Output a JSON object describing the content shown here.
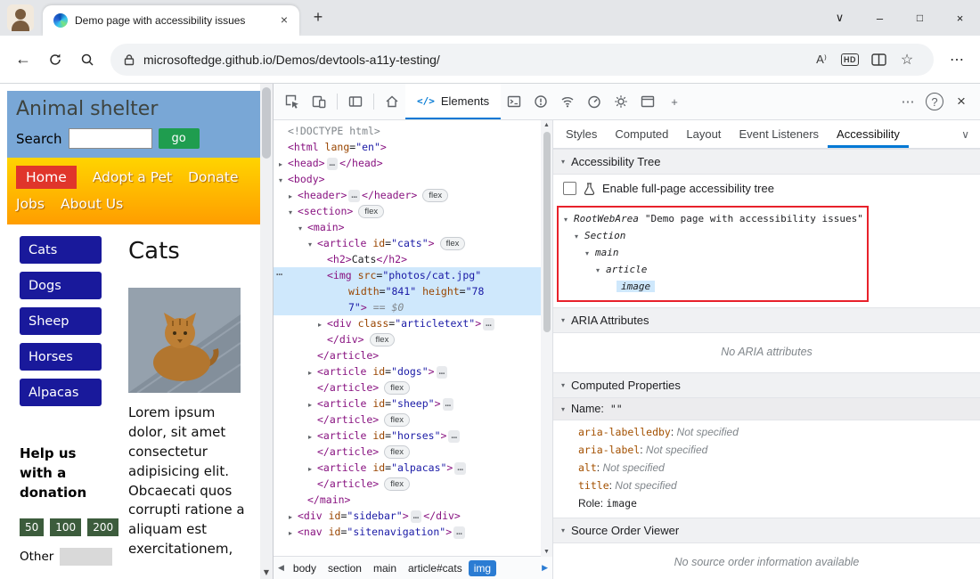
{
  "colors": {
    "devtools_accent": "#0078d4",
    "selection_highlight": "#cfe8fc",
    "inspect_highlight_red": "#e8212b",
    "code_tag": "#881280",
    "code_attr": "#994500",
    "code_value": "#1a1aa6",
    "page_header_blue": "#79a7d6",
    "page_nav_gradient_top": "#ffd400",
    "page_nav_gradient_bottom": "#ff9d00",
    "page_nav_active_red": "#e0352b",
    "page_button_navy": "#19199b",
    "page_go_green": "#1f9d4f",
    "page_donate_green": "#3c5c3c"
  },
  "icons": {
    "tab_close": "×",
    "new_tab": "+",
    "tab_search_chevron": "∨",
    "minimize": "–",
    "maximize": "□",
    "window_close": "×",
    "back": "←",
    "more": "⋯",
    "star": "☆",
    "read_aloud": "A⁾",
    "hd_badge": "HD",
    "help": "?",
    "devtools_close": "×",
    "elements_code": "</>",
    "add": "+",
    "crumb_left": "◀",
    "crumb_right": "▶",
    "scroll_up": "▲",
    "scroll_down": "▼",
    "collapsed": "▸",
    "expanded": "▾",
    "section_triangle": "▾",
    "panel_chevron": "∨",
    "node_menu": "…"
  },
  "browser": {
    "tab_title": "Demo page with accessibility issues",
    "url": "microsoftedge.github.io/Demos/devtools-a11y-testing/"
  },
  "webpage": {
    "title": "Animal shelter",
    "search_label": "Search",
    "go_button": "go",
    "active_nav": "Home",
    "nav_row1": [
      "Home",
      "Adopt a Pet",
      "Donate"
    ],
    "nav_row2": [
      "Jobs",
      "About Us"
    ],
    "category_buttons": [
      "Cats",
      "Dogs",
      "Sheep",
      "Horses",
      "Alpacas"
    ],
    "article_heading": "Cats",
    "article_text": "Lorem ipsum dolor, sit amet consectetur adipisicing elit. Obcaecati quos corrupti ratione a aliquam est exercitationem,",
    "donation_heading": "Help us with a donation",
    "donation_amounts": [
      "50",
      "100",
      "200"
    ],
    "other_label": "Other"
  },
  "devtools": {
    "elements_tab_label": "Elements",
    "panel_tabs": [
      "Styles",
      "Computed",
      "Layout",
      "Event Listeners",
      "Accessibility"
    ],
    "selected_panel_tab": "Accessibility",
    "breadcrumbs": [
      "body",
      "section",
      "main",
      "article#cats",
      "img"
    ],
    "selected_breadcrumb": "img",
    "tree_lines": [
      {
        "ind": 0,
        "segs": [
          [
            "doctype",
            "<!DOCTYPE html>"
          ]
        ]
      },
      {
        "ind": 0,
        "segs": [
          [
            "tag",
            "<html "
          ],
          [
            "attr",
            "lang"
          ],
          [
            "plain",
            "="
          ],
          [
            "val",
            "\"en\""
          ],
          [
            "tag",
            ">"
          ]
        ]
      },
      {
        "ind": 0,
        "arw": "c",
        "segs": [
          [
            "tag",
            "<head>"
          ],
          [
            "dots",
            "…"
          ],
          [
            "tag",
            "</head>"
          ]
        ]
      },
      {
        "ind": 0,
        "arw": "o",
        "segs": [
          [
            "tag",
            "<body>"
          ]
        ]
      },
      {
        "ind": 1,
        "arw": "c",
        "segs": [
          [
            "tag",
            "<header>"
          ],
          [
            "dots",
            "…"
          ],
          [
            "tag",
            "</header>"
          ],
          [
            "badge",
            "flex"
          ]
        ]
      },
      {
        "ind": 1,
        "arw": "o",
        "segs": [
          [
            "tag",
            "<section>"
          ],
          [
            "badge",
            "flex"
          ]
        ]
      },
      {
        "ind": 2,
        "arw": "o",
        "segs": [
          [
            "tag",
            "<main>"
          ]
        ]
      },
      {
        "ind": 3,
        "arw": "o",
        "segs": [
          [
            "tag",
            "<article "
          ],
          [
            "attr",
            "id"
          ],
          [
            "plain",
            "="
          ],
          [
            "val",
            "\"cats\""
          ],
          [
            "tag",
            ">"
          ],
          [
            "badge",
            "flex"
          ]
        ]
      },
      {
        "ind": 4,
        "segs": [
          [
            "tag",
            "<h2>"
          ],
          [
            "plain",
            "Cats"
          ],
          [
            "tag",
            "</h2>"
          ]
        ]
      },
      {
        "ind": 4,
        "sel": true,
        "gut": true,
        "segs": [
          [
            "tag",
            "<img "
          ],
          [
            "attr",
            "src"
          ],
          [
            "plain",
            "="
          ],
          [
            "val",
            "\"photos/cat.jpg\""
          ]
        ]
      },
      {
        "ind": 4,
        "sel": true,
        "cont": true,
        "segs": [
          [
            "attr",
            "width"
          ],
          [
            "plain",
            "="
          ],
          [
            "val",
            "\"841\""
          ],
          [
            "plain",
            " "
          ],
          [
            "attr",
            "height"
          ],
          [
            "plain",
            "="
          ],
          [
            "val",
            "\"78"
          ]
        ]
      },
      {
        "ind": 4,
        "sel": true,
        "cont": true,
        "segs": [
          [
            "val",
            "7\""
          ],
          [
            "tag",
            ">"
          ],
          [
            "eq",
            " == $0"
          ]
        ]
      },
      {
        "ind": 4,
        "arw": "c",
        "segs": [
          [
            "tag",
            "<div "
          ],
          [
            "attr",
            "class"
          ],
          [
            "plain",
            "="
          ],
          [
            "val",
            "\"articletext\""
          ],
          [
            "tag",
            ">"
          ],
          [
            "dots",
            "…"
          ]
        ]
      },
      {
        "ind": 4,
        "segs": [
          [
            "tag",
            "</div>"
          ],
          [
            "badge",
            "flex"
          ]
        ]
      },
      {
        "ind": 3,
        "segs": [
          [
            "tag",
            "</article>"
          ]
        ]
      },
      {
        "ind": 3,
        "arw": "c",
        "segs": [
          [
            "tag",
            "<article "
          ],
          [
            "attr",
            "id"
          ],
          [
            "plain",
            "="
          ],
          [
            "val",
            "\"dogs\""
          ],
          [
            "tag",
            ">"
          ],
          [
            "dots",
            "…"
          ]
        ]
      },
      {
        "ind": 3,
        "segs": [
          [
            "tag",
            "</article>"
          ],
          [
            "badge",
            "flex"
          ]
        ]
      },
      {
        "ind": 3,
        "arw": "c",
        "segs": [
          [
            "tag",
            "<article "
          ],
          [
            "attr",
            "id"
          ],
          [
            "plain",
            "="
          ],
          [
            "val",
            "\"sheep\""
          ],
          [
            "tag",
            ">"
          ],
          [
            "dots",
            "…"
          ]
        ]
      },
      {
        "ind": 3,
        "segs": [
          [
            "tag",
            "</article>"
          ],
          [
            "badge",
            "flex"
          ]
        ]
      },
      {
        "ind": 3,
        "arw": "c",
        "segs": [
          [
            "tag",
            "<article "
          ],
          [
            "attr",
            "id"
          ],
          [
            "plain",
            "="
          ],
          [
            "val",
            "\"horses\""
          ],
          [
            "tag",
            ">"
          ],
          [
            "dots",
            "…"
          ]
        ]
      },
      {
        "ind": 3,
        "segs": [
          [
            "tag",
            "</article>"
          ],
          [
            "badge",
            "flex"
          ]
        ]
      },
      {
        "ind": 3,
        "arw": "c",
        "segs": [
          [
            "tag",
            "<article "
          ],
          [
            "attr",
            "id"
          ],
          [
            "plain",
            "="
          ],
          [
            "val",
            "\"alpacas\""
          ],
          [
            "tag",
            ">"
          ],
          [
            "dots",
            "…"
          ]
        ]
      },
      {
        "ind": 3,
        "segs": [
          [
            "tag",
            "</article>"
          ],
          [
            "badge",
            "flex"
          ]
        ]
      },
      {
        "ind": 2,
        "segs": [
          [
            "tag",
            "</main>"
          ]
        ]
      },
      {
        "ind": 1,
        "arw": "c",
        "segs": [
          [
            "tag",
            "<div "
          ],
          [
            "attr",
            "id"
          ],
          [
            "plain",
            "="
          ],
          [
            "val",
            "\"sidebar\""
          ],
          [
            "tag",
            ">"
          ],
          [
            "dots",
            "…"
          ],
          [
            "tag",
            "</div>"
          ]
        ]
      },
      {
        "ind": 1,
        "arw": "c",
        "segs": [
          [
            "tag",
            "<nav "
          ],
          [
            "attr",
            "id"
          ],
          [
            "plain",
            "="
          ],
          [
            "val",
            "\"sitenavigation\""
          ],
          [
            "tag",
            ">"
          ],
          [
            "dots",
            "…"
          ]
        ]
      }
    ],
    "accessibility": {
      "tree_section_title": "Accessibility Tree",
      "enable_checkbox_label": "Enable full-page accessibility tree",
      "checkbox_checked": false,
      "ax_tree": [
        {
          "ind": 0,
          "arw": true,
          "role": "RootWebArea",
          "name": "\"Demo page with accessibility issues\""
        },
        {
          "ind": 1,
          "arw": true,
          "role": "Section"
        },
        {
          "ind": 2,
          "arw": true,
          "role": "main"
        },
        {
          "ind": 3,
          "arw": true,
          "role": "article"
        },
        {
          "ind": 4,
          "sel": true,
          "role": "image"
        }
      ],
      "aria_section_title": "ARIA Attributes",
      "aria_empty_text": "No ARIA attributes",
      "computed_section_title": "Computed Properties",
      "name_label": "Name:",
      "name_value": "\"\"",
      "computed_properties": [
        {
          "key": "aria-labelledby",
          "value": "Not specified",
          "value_style": "notset"
        },
        {
          "key": "aria-label",
          "value": "Not specified",
          "value_style": "notset"
        },
        {
          "key": "alt",
          "value": "Not specified",
          "value_style": "notset"
        },
        {
          "key": "title",
          "value": "Not specified",
          "value_style": "notset"
        },
        {
          "key": "Role",
          "plain_key": true,
          "value": "image",
          "value_style": "mono"
        }
      ],
      "source_section_title": "Source Order Viewer",
      "source_empty_text": "No source order information available"
    }
  }
}
